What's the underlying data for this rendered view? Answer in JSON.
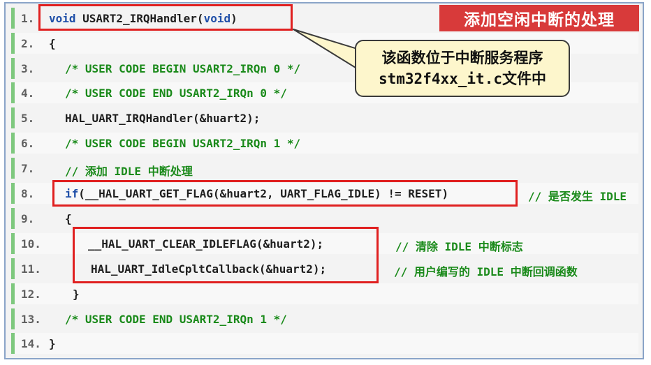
{
  "title_badge": "添加空闲中断的处理",
  "callout": {
    "line1": "该函数位于中断服务程序",
    "line2_code": "stm32f4xx_it.c",
    "line2_text": "文件中"
  },
  "lines": [
    {
      "num": "1.",
      "kw": "void",
      "text": " USART2_IRQHandler(",
      "kw2": "void",
      "text2": ")"
    },
    {
      "num": "2.",
      "text": "{"
    },
    {
      "num": "3.",
      "comment": "/* USER CODE BEGIN USART2_IRQn 0 */"
    },
    {
      "num": "4.",
      "comment": "/* USER CODE END USART2_IRQn 0 */"
    },
    {
      "num": "5.",
      "text": "HAL_UART_IRQHandler(&huart2);"
    },
    {
      "num": "6.",
      "comment": "/* USER CODE BEGIN USART2_IRQn 1 */"
    },
    {
      "num": "7.",
      "comment": "// 添加 IDLE 中断处理"
    },
    {
      "num": "8.",
      "kw": "if",
      "text": "(__HAL_UART_GET_FLAG(&huart2, UART_FLAG_IDLE) != RESET)",
      "comment": "// 是否发生 IDLE"
    },
    {
      "num": "9.",
      "text": "{"
    },
    {
      "num": "10.",
      "text": "__HAL_UART_CLEAR_IDLEFLAG(&huart2);",
      "comment": "// 清除 IDLE 中断标志"
    },
    {
      "num": "11.",
      "text": "HAL_UART_IdleCpltCallback(&huart2);",
      "comment": "// 用户编写的 IDLE 中断回调函数"
    },
    {
      "num": "12.",
      "text": "}"
    },
    {
      "num": "13.",
      "comment": "/* USER CODE END USART2_IRQn 1 */"
    },
    {
      "num": "14.",
      "text": "}"
    }
  ],
  "colors": {
    "accent_red": "#e02020",
    "keyword": "#1f4fa8",
    "comment": "#1a8a1a",
    "gutter": "#7ec87e",
    "callout_bg": "#fdf6cc"
  }
}
